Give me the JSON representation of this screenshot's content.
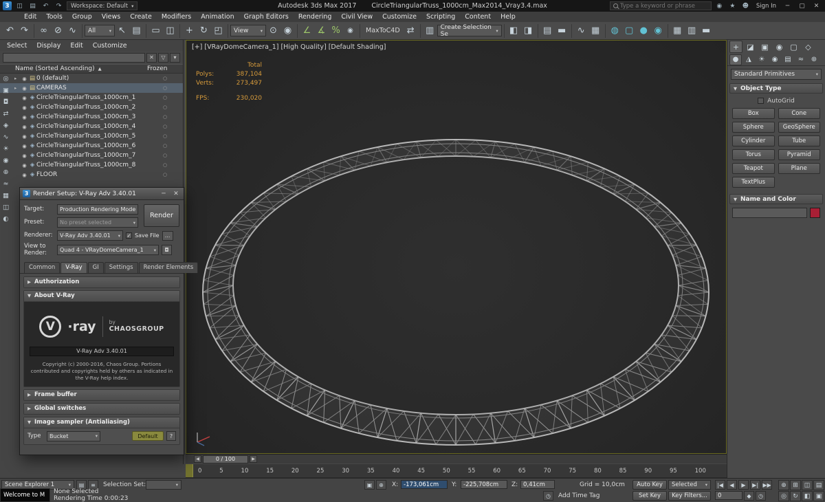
{
  "titlebar": {
    "app_title": "Autodesk 3ds Max 2017",
    "doc_title": "CircleTriangularTruss_1000cm_Max2014_Vray3.4.max",
    "workspace_label": "Workspace: Default",
    "search_placeholder": "Type a keyword or phrase",
    "sign_in_label": "Sign In"
  },
  "menubar": {
    "items": [
      "Edit",
      "Tools",
      "Group",
      "Views",
      "Create",
      "Modifiers",
      "Animation",
      "Graph Editors",
      "Rendering",
      "Civil View",
      "Customize",
      "Scripting",
      "Content",
      "Help"
    ]
  },
  "toolbar": {
    "filter_value": "All",
    "view_value": "View",
    "plugin_label": "MaxToC4D",
    "selection_set_value": "Create Selection Se"
  },
  "scene_explorer": {
    "menus": [
      "Select",
      "Display",
      "Edit",
      "Customize"
    ],
    "name_column": "Name (Sorted Ascending)",
    "sort_indicator": "▲",
    "frozen_column": "Frozen",
    "rows": [
      {
        "label": "0 (default)",
        "kind": "layer"
      },
      {
        "label": "CAMERAS",
        "kind": "layer"
      },
      {
        "label": "CircleTriangularTruss_1000cm_1",
        "kind": "object"
      },
      {
        "label": "CircleTriangularTruss_1000cm_2",
        "kind": "object"
      },
      {
        "label": "CircleTriangularTruss_1000cm_3",
        "kind": "object"
      },
      {
        "label": "CircleTriangularTruss_1000cm_4",
        "kind": "object"
      },
      {
        "label": "CircleTriangularTruss_1000cm_5",
        "kind": "object"
      },
      {
        "label": "CircleTriangularTruss_1000cm_6",
        "kind": "object"
      },
      {
        "label": "CircleTriangularTruss_1000cm_7",
        "kind": "object"
      },
      {
        "label": "CircleTriangularTruss_1000cm_8",
        "kind": "object"
      },
      {
        "label": "FLOOR",
        "kind": "object"
      }
    ]
  },
  "render_dialog": {
    "title": "Render Setup: V-Ray Adv 3.40.01",
    "target_label": "Target:",
    "target_value": "Production Rendering Mode",
    "preset_label": "Preset:",
    "preset_value": "No preset selected",
    "renderer_label": "Renderer:",
    "renderer_value": "V-Ray Adv 3.40.01",
    "save_file_label": "Save File",
    "browse_label": "...",
    "render_button": "Render",
    "view_label": "View to Render:",
    "view_value": "Quad 4 - VRayDomeCamera_1",
    "tabs": [
      "Common",
      "V-Ray",
      "GI",
      "Settings",
      "Render Elements"
    ],
    "rollout_authorization": "Authorization",
    "rollout_about": "About V-Ray",
    "rollout_frame_buffer": "Frame buffer",
    "rollout_global_switches": "Global switches",
    "rollout_image_sampler": "Image sampler (Antialiasing)",
    "about": {
      "logo_v": "V",
      "logo_ray": "·ray",
      "by_label": "by",
      "company": "CHAOSGROUP",
      "version": "V-Ray Adv 3.40.01",
      "copyright1": "Copyright (c) 2000-2016, Chaos Group.",
      "copyright2": "Portions contributed and copyrights held by others as indicated in the V-Ray help index."
    },
    "sampler": {
      "type_label": "Type",
      "type_value": "Bucket",
      "default_button": "Default",
      "help_button": "?"
    }
  },
  "viewport": {
    "label": "[+] [VRayDomeCamera_1] [High Quality] [Default Shading]",
    "stats": {
      "total_label": "Total",
      "polys_label": "Polys:",
      "polys_value": "387,104",
      "verts_label": "Verts:",
      "verts_value": "273,497",
      "fps_label": "FPS:",
      "fps_value": "230,020"
    },
    "time_slider": "0 / 100"
  },
  "command_panel": {
    "category_value": "Standard Primitives",
    "object_type_rollout": "Object Type",
    "autogrid_label": "AutoGrid",
    "buttons": [
      "Box",
      "Cone",
      "Sphere",
      "GeoSphere",
      "Cylinder",
      "Tube",
      "Torus",
      "Pyramid",
      "Teapot",
      "Plane",
      "TextPlus"
    ],
    "name_color_rollout": "Name and Color",
    "swatch_style": "background:#a81f35"
  },
  "timeline": {
    "ticks": [
      "0",
      "5",
      "10",
      "15",
      "20",
      "25",
      "30",
      "35",
      "40",
      "45",
      "50",
      "55",
      "60",
      "65",
      "70",
      "75",
      "80",
      "85",
      "90",
      "95",
      "100"
    ]
  },
  "statusbar": {
    "explorer_name": "Scene Explorer 1",
    "selection_set_label": "Selection Set:",
    "none_selected": "None Selected",
    "rendering_time": "Rendering Time 0:00:23",
    "welcome_title": "Welcome to M",
    "x_label": "X:",
    "x_value": "-173,061cm",
    "y_label": "Y:",
    "y_value": "-225,708cm",
    "z_label": "Z:",
    "z_value": "0,41cm",
    "grid_label": "Grid = 10,0cm",
    "add_time_tag": "Add Time Tag",
    "frame_value": "0",
    "auto_key_label": "Auto Key",
    "selected_value": "Selected",
    "set_key_label": "Set Key",
    "key_filters_label": "Key Filters..."
  }
}
